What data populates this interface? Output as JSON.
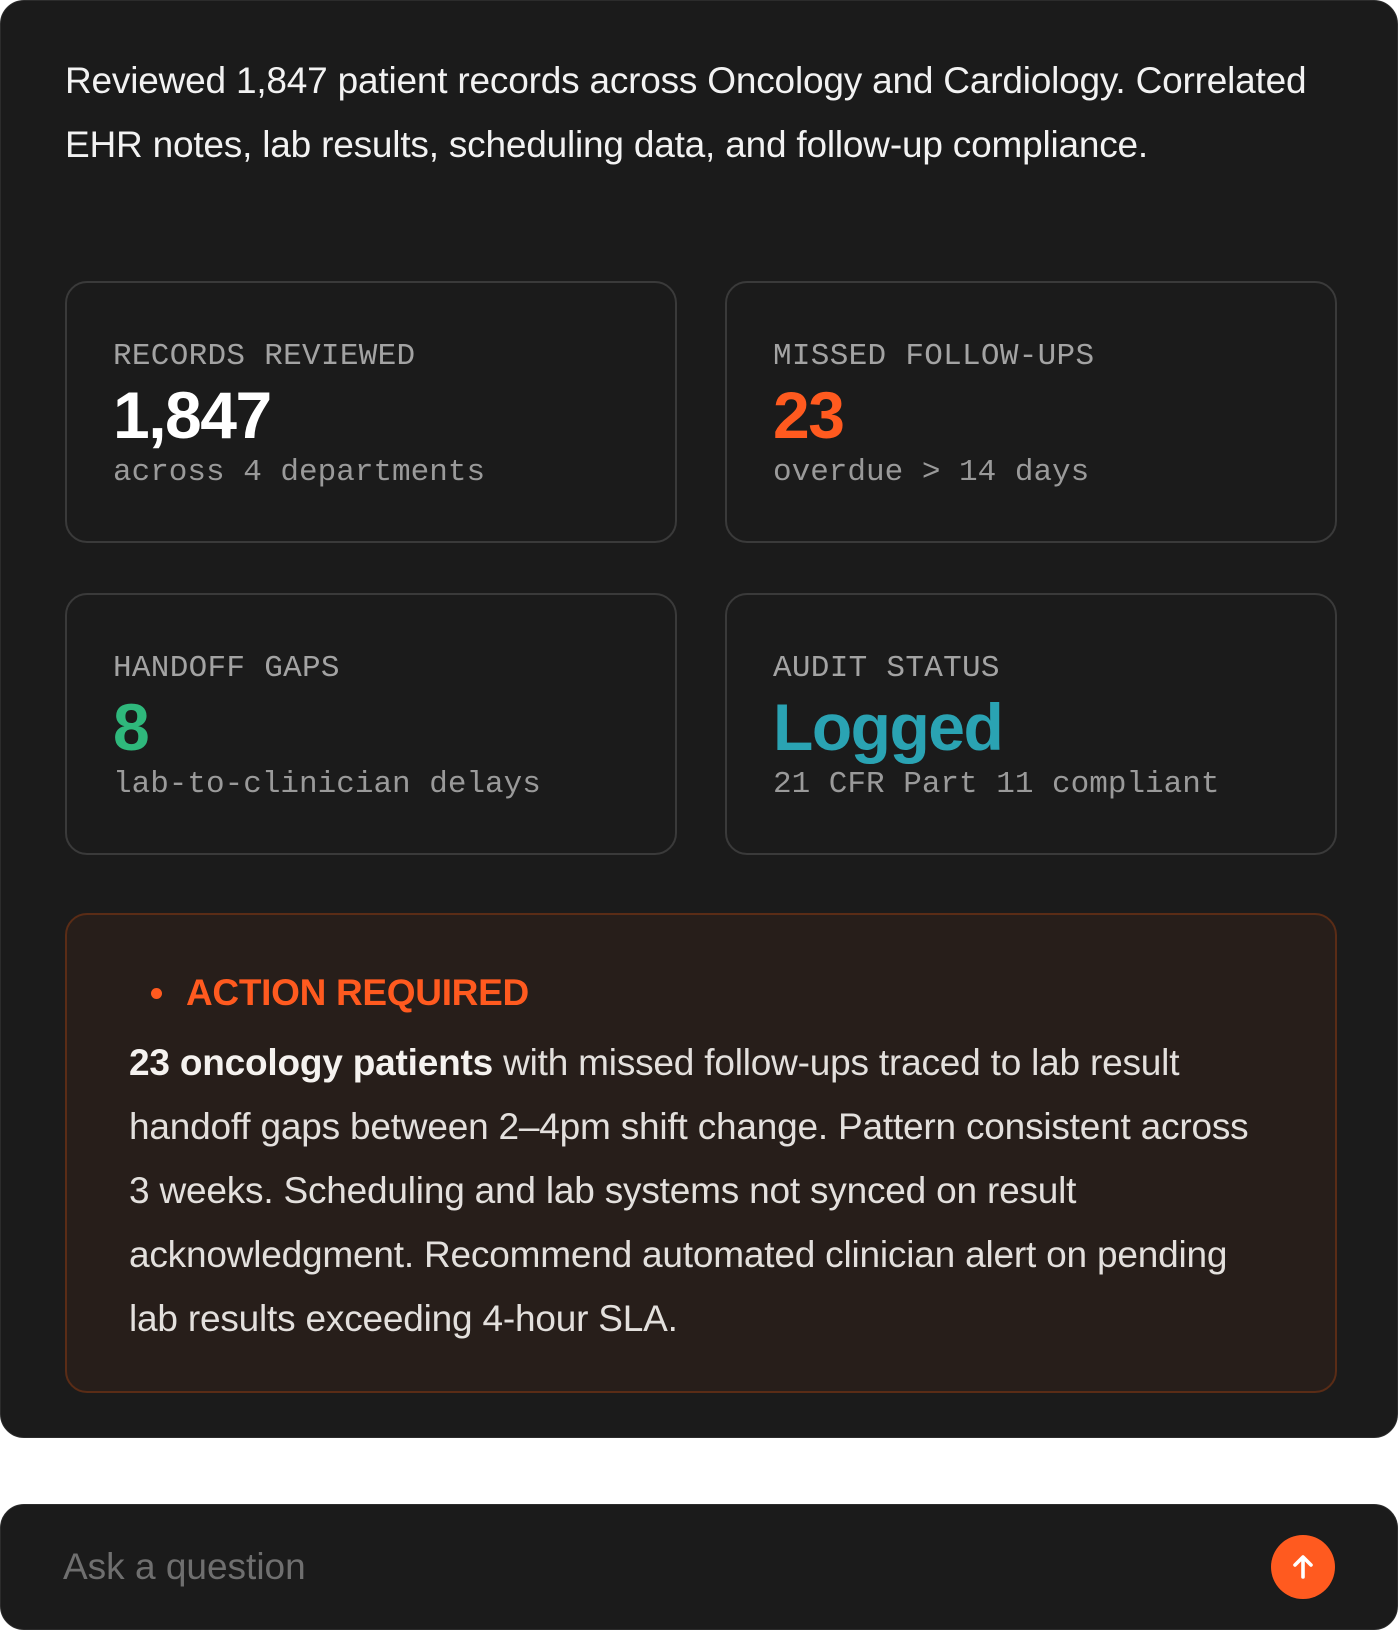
{
  "summary": {
    "text": "Reviewed 1,847 patient records across Oncology and Cardiology. Correlated EHR notes, lab results, scheduling data, and follow-up compliance."
  },
  "stats": [
    {
      "label": "RECORDS REVIEWED",
      "value": "1,847",
      "sub": "across 4 departments",
      "color": "#ffffff"
    },
    {
      "label": "MISSED FOLLOW-UPS",
      "value": "23",
      "sub": "overdue > 14 days",
      "color": "#ff5a1f"
    },
    {
      "label": "HANDOFF GAPS",
      "value": "8",
      "sub": "lab-to-clinician delays",
      "color": "#2fb87c"
    },
    {
      "label": "AUDIT STATUS",
      "value": "Logged",
      "sub": "21 CFR Part 11 compliant",
      "color": "#2aa3b3"
    }
  ],
  "alert": {
    "title": "ACTION REQUIRED",
    "highlight": "23 oncology patients",
    "body": " with missed follow-ups traced to lab result handoff gaps between 2–4pm shift change. Pattern consistent across 3 weeks. Scheduling and lab systems not synced on result acknowledgment. Recommend automated clinician alert on pending lab results exceeding 4-hour SLA.",
    "accent_color": "#ff5a1f"
  },
  "ask": {
    "placeholder": "Ask a question",
    "value": "",
    "send_icon": "arrow-up-icon"
  }
}
